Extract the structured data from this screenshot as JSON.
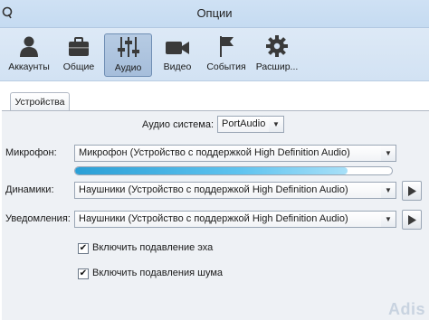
{
  "window": {
    "title": "Опции"
  },
  "toolbar": {
    "items": [
      {
        "label": "Аккаунты",
        "icon": "person-icon"
      },
      {
        "label": "Общие",
        "icon": "briefcase-icon"
      },
      {
        "label": "Аудио",
        "icon": "sliders-icon",
        "active": true
      },
      {
        "label": "Видео",
        "icon": "video-camera-icon"
      },
      {
        "label": "События",
        "icon": "flag-icon"
      },
      {
        "label": "Расшир...",
        "icon": "gear-icon"
      }
    ]
  },
  "tabs": {
    "active_label": "Устройства"
  },
  "audio_system": {
    "label": "Аудио система:",
    "value": "PortAudio"
  },
  "microphone": {
    "label": "Микрофон:",
    "value": "Микрофон (Устройство с поддержкой High Definition Audio)",
    "level_percent": 86
  },
  "speakers": {
    "label": "Динамики:",
    "value": "Наушники (Устройство с поддержкой High Definition Audio)"
  },
  "notifications": {
    "label": "Уведомления:",
    "value": "Наушники (Устройство с поддержкой High Definition Audio)"
  },
  "options": {
    "echo_cancel": {
      "label": "Включить подавление эха",
      "checked": true
    },
    "noise_suppress": {
      "label": "Включить подавления шума",
      "checked": true
    }
  },
  "colors": {
    "accent": "#2a9fd6",
    "titlebar": "#c9def3",
    "panel": "#eef1f5"
  },
  "watermark": "Adis"
}
